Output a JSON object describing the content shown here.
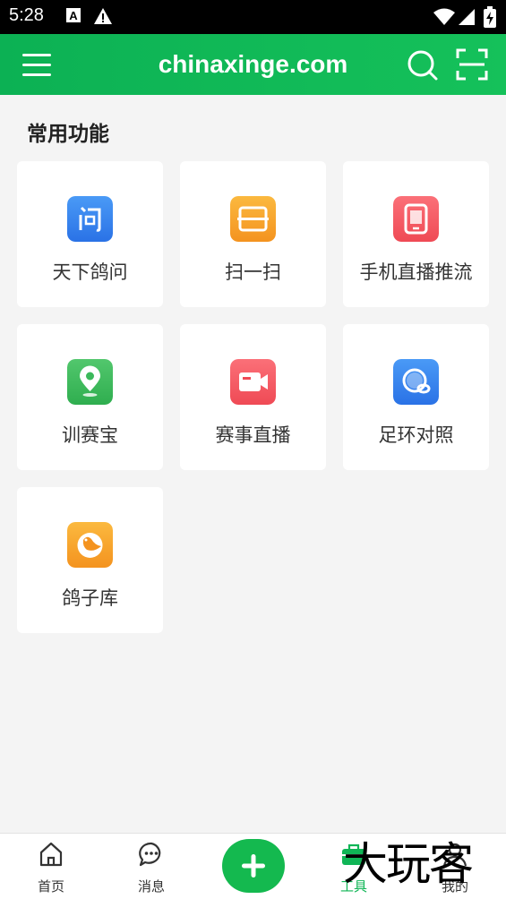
{
  "status": {
    "time": "5:28"
  },
  "appbar": {
    "title": "chinaxinge.com"
  },
  "section": {
    "title": "常用功能"
  },
  "tools": [
    {
      "label": "天下鸽问",
      "icon": "question-chat-icon",
      "color": "#2f80ed"
    },
    {
      "label": "扫一扫",
      "icon": "scan-icon",
      "color": "#f7a22a"
    },
    {
      "label": "手机直播推流",
      "icon": "phone-stream-icon",
      "color": "#f25a62"
    },
    {
      "label": "训赛宝",
      "icon": "location-pin-icon",
      "color": "#3cb95b"
    },
    {
      "label": "赛事直播",
      "icon": "video-camera-icon",
      "color": "#f25a62"
    },
    {
      "label": "足环对照",
      "icon": "ring-compare-icon",
      "color": "#2f80ed"
    },
    {
      "label": "鸽子库",
      "icon": "pigeon-icon",
      "color": "#f7a22a"
    }
  ],
  "tabs": [
    {
      "label": "首页",
      "icon": "home-icon"
    },
    {
      "label": "消息",
      "icon": "message-icon"
    },
    {
      "label": "工具",
      "icon": "toolbox-icon",
      "active": true
    },
    {
      "label": "我的",
      "icon": "profile-icon"
    }
  ],
  "watermark": "大玩客",
  "colors": {
    "brand": "#10b556",
    "active_tab": "#10b556"
  }
}
